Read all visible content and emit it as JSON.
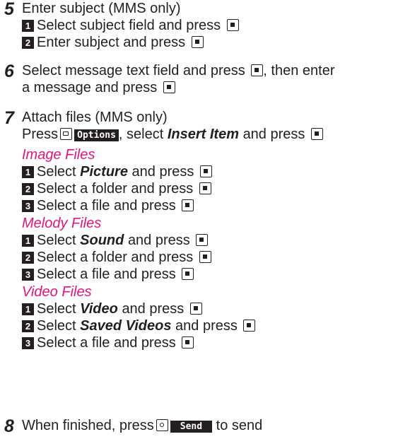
{
  "steps": [
    {
      "num": "5",
      "title": "Enter subject (MMS only)",
      "sub": [
        {
          "n": "1",
          "text": "Select subject field and press"
        },
        {
          "n": "2",
          "text": "Enter subject and press"
        }
      ]
    },
    {
      "num": "6",
      "line1a": "Select message text field and press",
      "line1b": ", then enter",
      "line2": "a message and press"
    },
    {
      "num": "7",
      "title": "Attach files (MMS only)",
      "line2a": "Press",
      "softkey": "Options",
      "line2b": ", select",
      "line2c": "Insert Item",
      "line2d": "and press",
      "groups": [
        {
          "heading": "Image Files",
          "items": [
            {
              "n": "1",
              "a": "Select",
              "em": "Picture",
              "b": "and press"
            },
            {
              "n": "2",
              "a": "Select a folder and press",
              "em": "",
              "b": ""
            },
            {
              "n": "3",
              "a": "Select a file and press",
              "em": "",
              "b": ""
            }
          ]
        },
        {
          "heading": "Melody Files",
          "items": [
            {
              "n": "1",
              "a": "Select",
              "em": "Sound",
              "b": "and press"
            },
            {
              "n": "2",
              "a": "Select a folder and press",
              "em": "",
              "b": ""
            },
            {
              "n": "3",
              "a": "Select a file and press",
              "em": "",
              "b": ""
            }
          ]
        },
        {
          "heading": "Video Files",
          "items": [
            {
              "n": "1",
              "a": "Select",
              "em": "Video",
              "b": "and press"
            },
            {
              "n": "2",
              "a": "Select",
              "em": "Saved Videos",
              "b": "and press"
            },
            {
              "n": "3",
              "a": "Select a file and press",
              "em": "",
              "b": ""
            }
          ]
        }
      ]
    },
    {
      "num": "8",
      "a": "When finished, press",
      "softkey": "Send",
      "b": "to send"
    }
  ]
}
